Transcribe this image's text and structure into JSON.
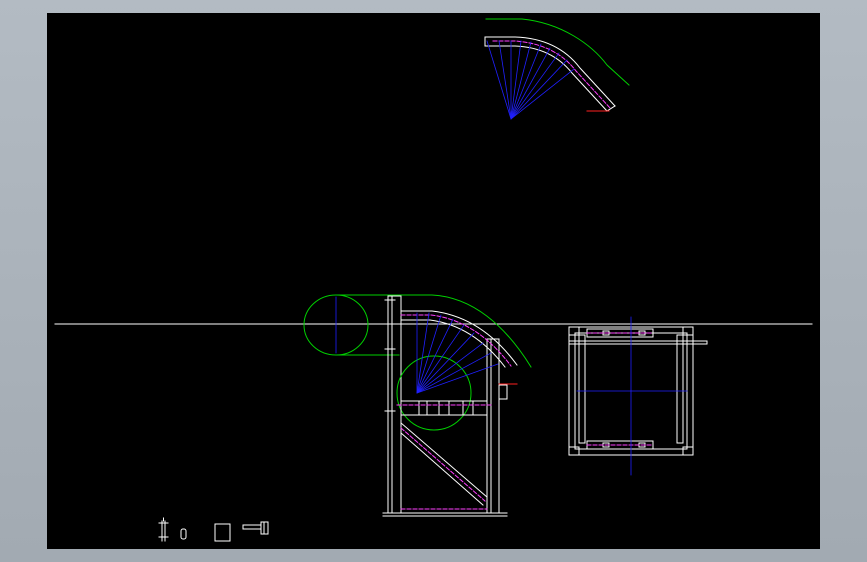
{
  "canvas": {
    "background": "#000000",
    "frame_color": "#a7afb7"
  },
  "colors": {
    "geometry": "#ffffff",
    "construction": "#00d000",
    "center_lines": "#2020ff",
    "hidden_lines": "#ff40ff",
    "markers": "#ff2020"
  },
  "views": [
    {
      "name": "top-view-bent-tube",
      "type": "plan"
    },
    {
      "name": "front-view-pipe-bender",
      "type": "elevation"
    },
    {
      "name": "side-view-frame",
      "type": "elevation"
    }
  ],
  "ucs_icon": "coordinate-system-icon"
}
